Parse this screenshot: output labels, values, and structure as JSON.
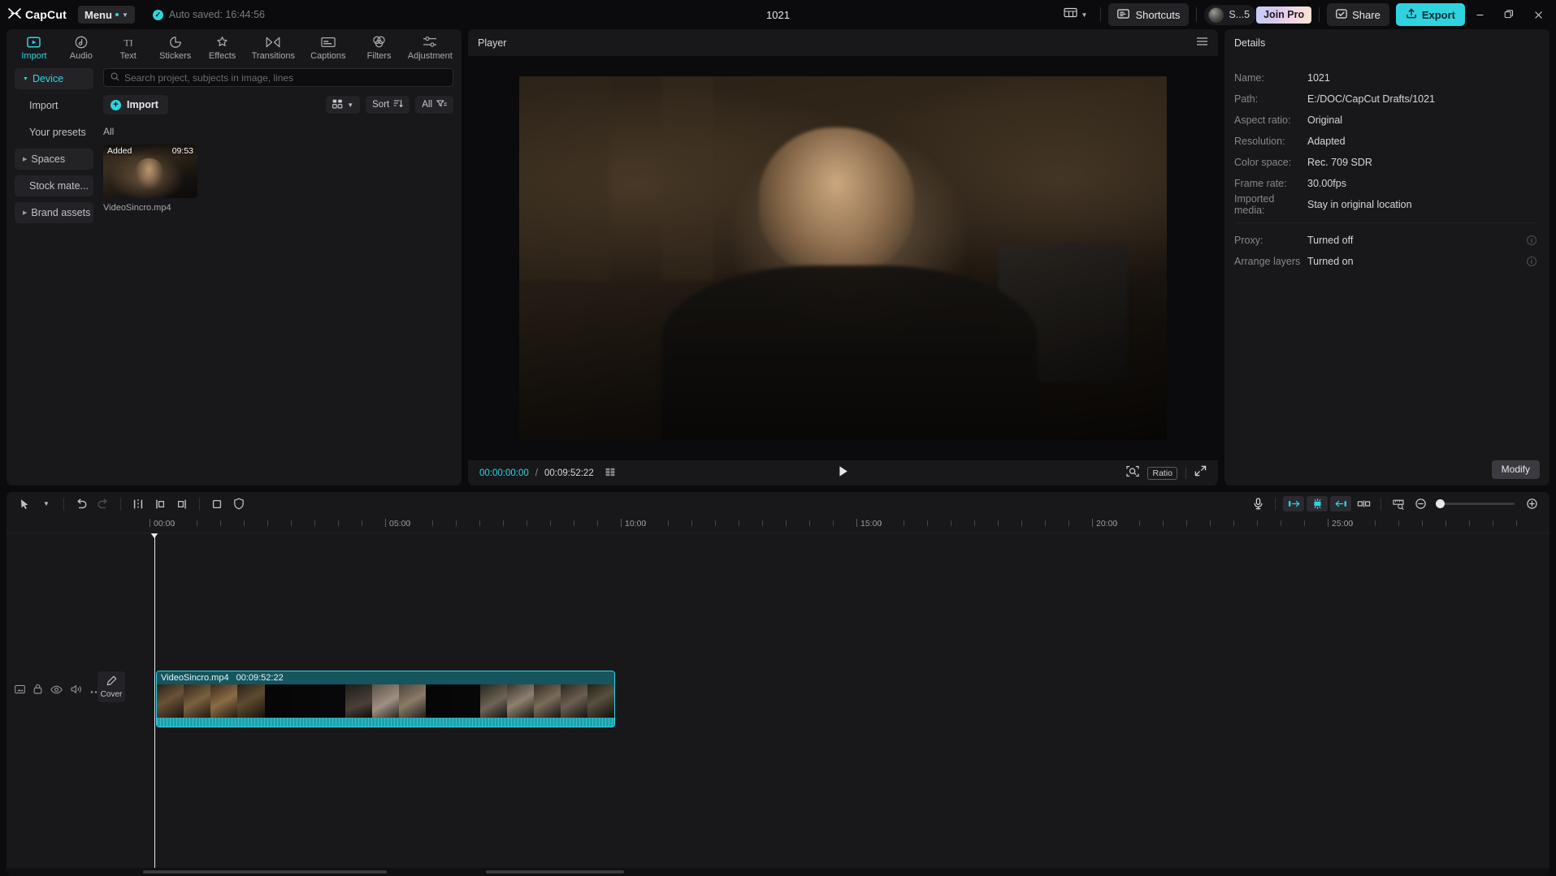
{
  "titlebar": {
    "brand": "CapCut",
    "menu_label": "Menu",
    "autosave_text": "Auto  saved: 16:44:56",
    "project_title": "1021",
    "layout_icon": "layout-grid-icon",
    "shortcuts_label": "Shortcuts",
    "account_name": "S...5",
    "join_pro_label": "Join Pro",
    "share_label": "Share",
    "export_label": "Export",
    "window_minimize": "–",
    "window_maximize": "❐",
    "window_close": "✕"
  },
  "tabs": [
    {
      "label": "Import",
      "icon": "import-icon",
      "active": true
    },
    {
      "label": "Audio",
      "icon": "audio-icon",
      "active": false
    },
    {
      "label": "Text",
      "icon": "text-icon",
      "active": false
    },
    {
      "label": "Stickers",
      "icon": "stickers-icon",
      "active": false
    },
    {
      "label": "Effects",
      "icon": "effects-icon",
      "active": false
    },
    {
      "label": "Transitions",
      "icon": "transitions-icon",
      "active": false
    },
    {
      "label": "Captions",
      "icon": "captions-icon",
      "active": false
    },
    {
      "label": "Filters",
      "icon": "filters-icon",
      "active": false
    },
    {
      "label": "Adjustment",
      "icon": "adjustment-icon",
      "active": false
    }
  ],
  "sidebar": {
    "items": [
      {
        "label": "Device",
        "type": "group",
        "expanded": true,
        "selected": true
      },
      {
        "label": "Import",
        "type": "sub",
        "expanded": false,
        "selected": false
      },
      {
        "label": "Your presets",
        "type": "sub",
        "expanded": false,
        "selected": false
      },
      {
        "label": "Spaces",
        "type": "group",
        "expanded": false,
        "selected": false
      },
      {
        "label": "Stock mate...",
        "type": "plain",
        "expanded": false,
        "selected": false
      },
      {
        "label": "Brand assets",
        "type": "group",
        "expanded": false,
        "selected": false
      }
    ]
  },
  "library": {
    "search_placeholder": "Search project, subjects in image, lines",
    "search_value": "",
    "search_icon": "search-icon",
    "import_label": "Import",
    "view_label": "grid-view-icon",
    "sort_label": "Sort",
    "filter_label": "All",
    "section_label": "All",
    "media": [
      {
        "badge": "Added",
        "duration": "09:53",
        "name": "VideoSincro.mp4"
      }
    ]
  },
  "player": {
    "title": "Player",
    "menu_icon": "player-menu-icon",
    "current_time": "00:00:00:00",
    "time_separator": "/",
    "total_time": "00:09:52:22",
    "frames_icon": "frames-icon",
    "play_icon": "play-icon",
    "zoom_icon": "magnify-icon",
    "ratio_label": "Ratio",
    "fullscreen_icon": "fullscreen-icon"
  },
  "details": {
    "title": "Details",
    "rows": [
      {
        "label": "Name:",
        "value": "1021"
      },
      {
        "label": "Path:",
        "value": "E:/DOC/CapCut Drafts/1021"
      },
      {
        "label": "Aspect ratio:",
        "value": "Original"
      },
      {
        "label": "Resolution:",
        "value": "Adapted"
      },
      {
        "label": "Color space:",
        "value": "Rec. 709 SDR"
      },
      {
        "label": "Frame rate:",
        "value": "30.00fps"
      },
      {
        "label": "Imported media:",
        "value": "Stay in original location"
      }
    ],
    "toggles": [
      {
        "label": "Proxy:",
        "value": "Turned off",
        "info": "info-icon"
      },
      {
        "label": "Arrange layers",
        "value": "Turned on",
        "info": "info-icon"
      }
    ],
    "modify_label": "Modify"
  },
  "timeline": {
    "toolbar": {
      "select_icon": "select-arrow-icon",
      "select_caret": "chevron-down-icon",
      "undo_icon": "undo-icon",
      "redo_icon": "redo-icon",
      "split_icon": "split-icon",
      "trim_left_icon": "trim-left-icon",
      "trim_right_icon": "trim-right-icon",
      "crop_icon": "crop-icon",
      "mask_icon": "shield-icon",
      "mic_icon": "microphone-icon",
      "mirror_left_icon": "mirror-left-icon",
      "flash_icon": "flash-select-icon",
      "mirror_right_icon": "mirror-right-icon",
      "link_icon": "link-clips-icon",
      "ruler_icon": "ruler-icon",
      "zoom_out_icon": "zoom-out-icon",
      "zoom_level": 0
    },
    "ruler_labels": [
      "00:00",
      "05:00",
      "10:00",
      "15:00",
      "20:00",
      "25:00"
    ],
    "playhead_time": "00:00",
    "track_header": {
      "cover_label": "Cover",
      "cover_icon": "cover-edit-icon",
      "icons": [
        "track-thumb-icon",
        "lock-icon",
        "eye-icon",
        "mute-icon",
        "more-icon"
      ]
    },
    "clip": {
      "name": "VideoSincro.mp4",
      "duration": "00:09:52:22"
    }
  },
  "colors": {
    "accent": "#2fd3e0",
    "panel_bg": "#18181b",
    "app_bg": "#0b0b0d",
    "clip_teal": "#14555e",
    "audio_teal": "#18a3b0"
  }
}
